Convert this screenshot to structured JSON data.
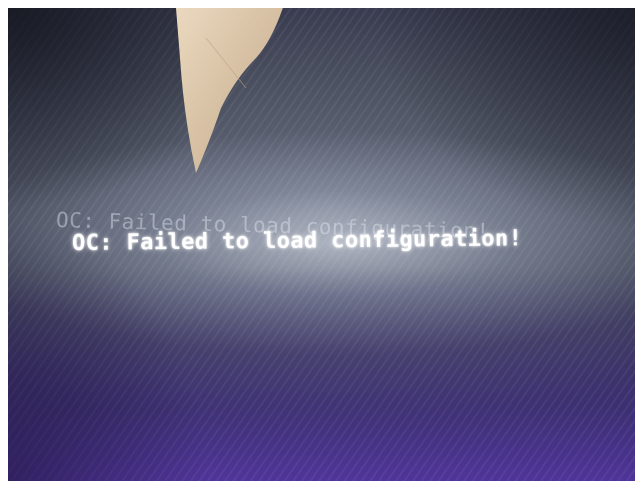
{
  "screen": {
    "boot_message": "OC: Failed to load configuration!",
    "ghost_message": "OC: Failed to load configuration!"
  },
  "colors": {
    "text": "#ffffff",
    "background_center": "#6b7283",
    "background_bottom": "#5a37b4"
  }
}
